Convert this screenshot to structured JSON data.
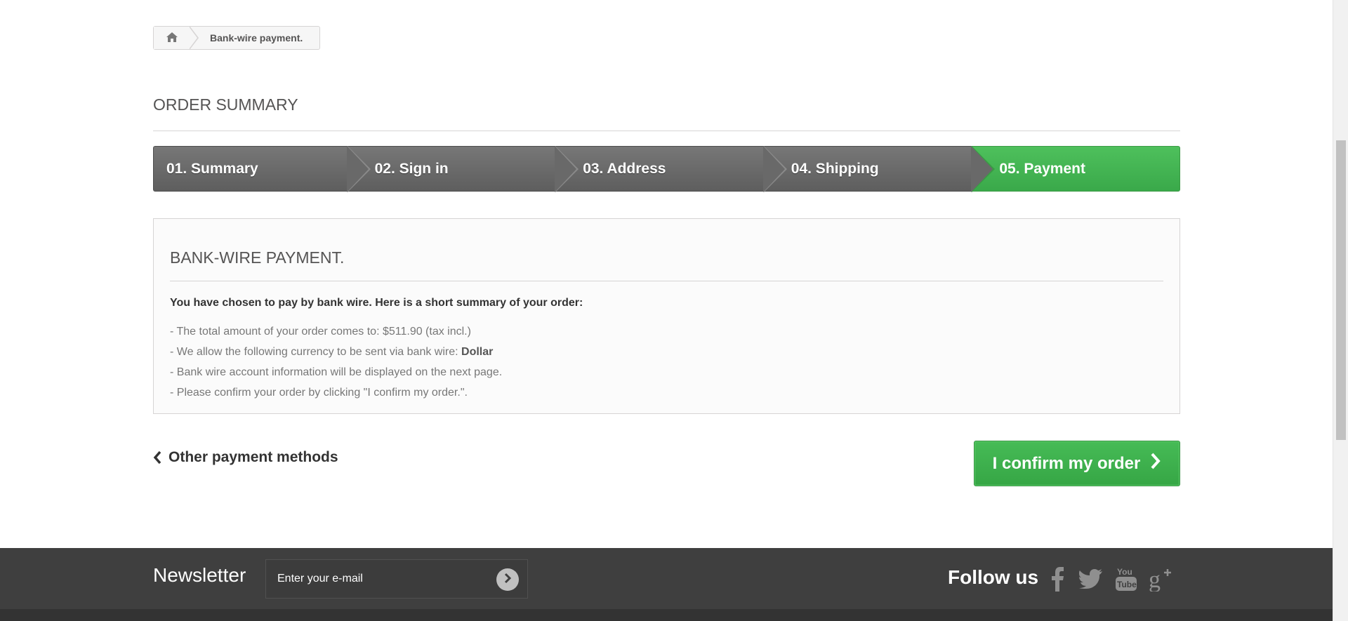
{
  "breadcrumb": {
    "home_icon": "home-icon",
    "current": "Bank-wire payment."
  },
  "page": {
    "heading": "Order summary"
  },
  "steps": [
    {
      "label": "01. Summary",
      "active": false
    },
    {
      "label": "02. Sign in",
      "active": false
    },
    {
      "label": "03. Address",
      "active": false
    },
    {
      "label": "04. Shipping",
      "active": false
    },
    {
      "label": "05. Payment",
      "active": true
    }
  ],
  "payment": {
    "title": "Bank-wire payment.",
    "lead": "You have chosen to pay by bank wire. Here is a short summary of your order:",
    "total_line": "- The total amount of your order comes to: $511.90 (tax incl.)",
    "currency_prefix": "- We allow the following currency to be sent via bank wire: ",
    "currency": "Dollar",
    "info_line": "- Bank wire account information will be displayed on the next page.",
    "confirm_line": "- Please confirm your order by clicking \"I confirm my order.\"."
  },
  "actions": {
    "back_label": "Other payment methods",
    "confirm_label": "I confirm my order"
  },
  "footer": {
    "newsletter_title": "Newsletter",
    "newsletter_placeholder": "Enter your e-mail",
    "follow_title": "Follow us",
    "social": [
      "facebook-icon",
      "twitter-icon",
      "youtube-icon",
      "google-plus-icon"
    ]
  },
  "colors": {
    "accent_green": "#46bb56",
    "step_gray": "#6b6b6b",
    "footer_bg": "#3f3f3f"
  }
}
